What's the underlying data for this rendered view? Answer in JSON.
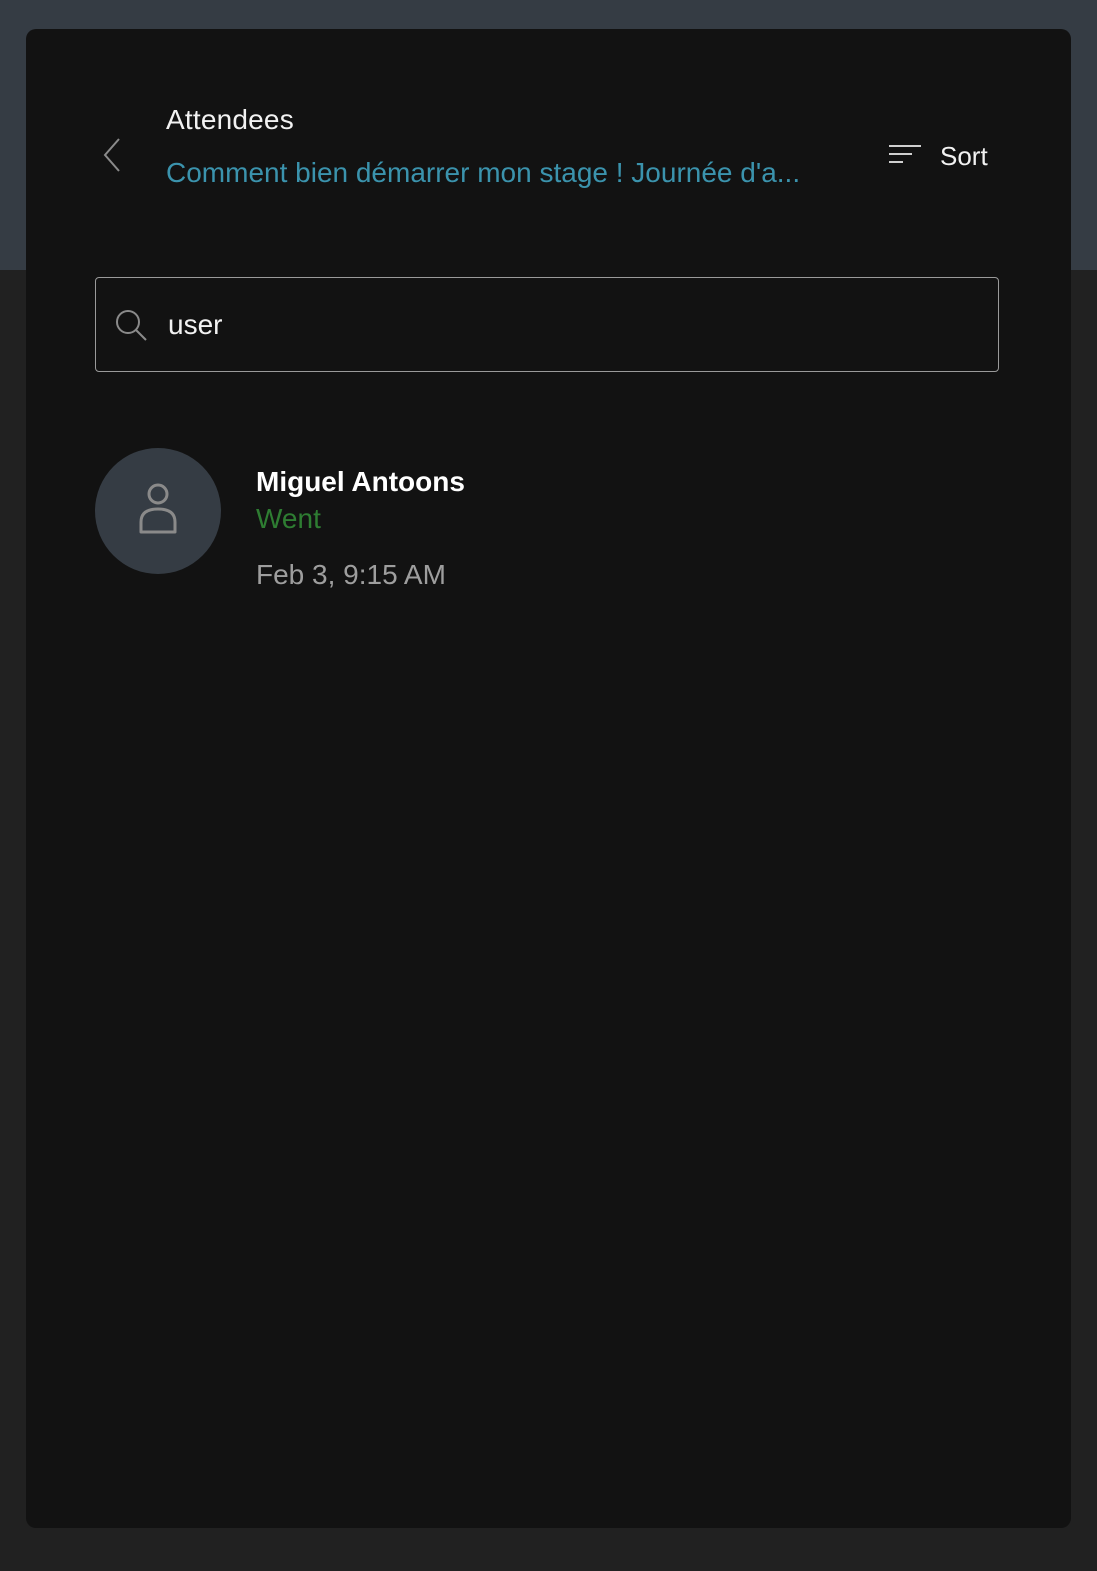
{
  "header": {
    "title": "Attendees",
    "subtitle": "Comment bien démarrer mon stage ! Journée d'a...",
    "sort_label": "Sort"
  },
  "search": {
    "value": "user",
    "placeholder": ""
  },
  "attendees": [
    {
      "name": "Miguel Antoons",
      "status": "Went",
      "timestamp": "Feb 3, 9:15 AM"
    }
  ],
  "colors": {
    "top_band": "#353c44",
    "panel_bg": "#121212",
    "page_bg": "#212121",
    "subtitle_link": "#3b93ad",
    "status_went": "#2e7d32",
    "avatar_bg": "#353c44"
  },
  "icons": {
    "back": "chevron-left-icon",
    "sort": "sort-lines-icon",
    "search": "search-icon",
    "avatar": "person-icon"
  }
}
